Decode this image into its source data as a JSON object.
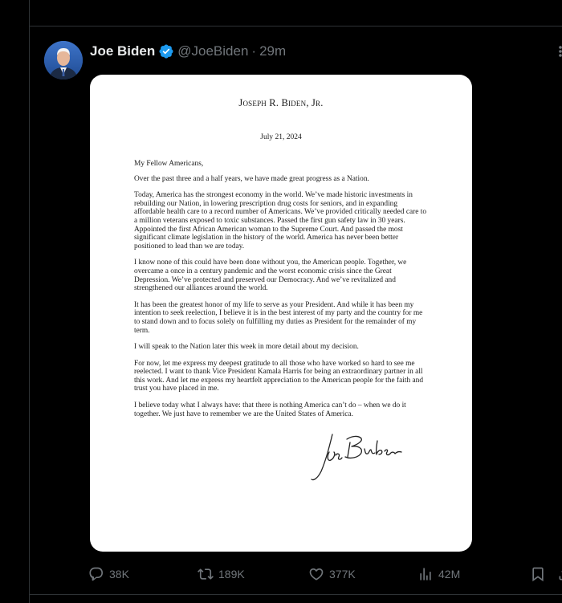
{
  "tweet": {
    "display_name": "Joe Biden",
    "handle": "@JoeBiden",
    "separator": "·",
    "time": "29m",
    "verified_icon": "verified-badge-icon",
    "colors": {
      "verified": "#1d9bf0",
      "muted": "#71767b",
      "text": "#e7e9ea",
      "background": "#000000"
    }
  },
  "letter": {
    "letterhead": "Joseph R. Biden, Jr.",
    "date": "July 21, 2024",
    "salutation": "My Fellow Americans,",
    "paragraphs": [
      "Over the past three and a half years, we have made great progress as a Nation.",
      "Today, America has the strongest economy in the world. We’ve made historic investments in rebuilding our Nation, in lowering prescription drug costs for seniors, and in expanding affordable health care to a record number of Americans. We’ve provided critically needed care to a million veterans exposed to toxic substances. Passed the first gun safety law in 30 years. Appointed the first African American woman to the Supreme Court. And passed the most significant climate legislation in the history of the world. America has never been better positioned to lead than we are today.",
      "I know none of this could have been done without you, the American people. Together, we overcame a once in a century pandemic and the worst economic crisis since the Great Depression. We’ve protected and preserved our Democracy. And we’ve revitalized and strengthened our alliances around the world.",
      "It has been the greatest honor of my life to serve as your President. And while it has been my intention to seek reelection, I believe it is in the best interest of my party and the country for me to stand down and to focus solely on fulfilling my duties as President for the remainder of my term.",
      "I will speak to the Nation later this week in more detail about my decision.",
      "For now, let me express my deepest gratitude to all those who have worked so hard to see me reelected. I want to thank Vice President Kamala Harris for being an extraordinary partner in all this work. And let me express my heartfelt appreciation to the American people for the faith and trust you have placed in me.",
      "I believe today what I always have: that there is nothing America can’t do – when we do it together. We just have to remember we are the United States of America."
    ],
    "signature": "Joe Biden"
  },
  "actions": {
    "reply_count": "38K",
    "repost_count": "189K",
    "like_count": "377K",
    "views_count": "42M"
  }
}
